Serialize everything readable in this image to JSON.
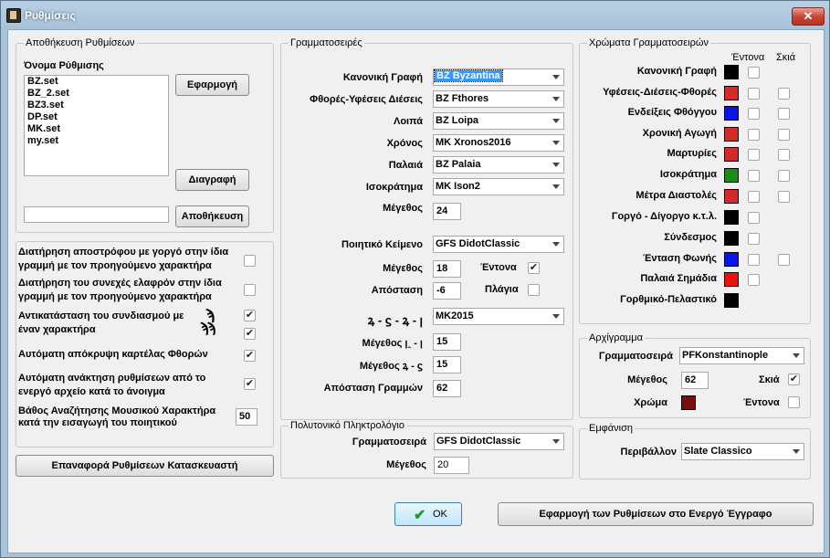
{
  "window": {
    "title": "Ρυθμίσεις",
    "close_glyph": "✕"
  },
  "save_settings": {
    "group_label": "Αποθήκευση Ρυθμίσεων",
    "name_label": "Όνομα Ρύθμισης",
    "items": [
      "BZ.set",
      "BZ_2.set",
      "BZ3.set",
      "DP.set",
      "MK.set",
      "my.set"
    ],
    "apply_button": "Εφαρμογή",
    "delete_button": "Διαγραφή",
    "save_button": "Αποθήκευση",
    "name_value": ""
  },
  "options": {
    "keep_apostrophe": {
      "label": "Διατήρηση αποστρόφου με γοργό στην ίδια γραμμή με τον προηγούμενο χαρακτήρα",
      "checked": false
    },
    "keep_continuous": {
      "label": "Διατήρηση του συνεχές ελαφρόν στην ίδια γραμμή με τον προηγούμενο χαρακτήρα",
      "checked": false
    },
    "replace_combo": {
      "label": "Αντικατάσταση του συνδιασμού με έναν χαρακτήρα",
      "checked_1": true,
      "checked_2": true,
      "glyph_1": "ϡ",
      "glyph_2": "ϡϡ"
    },
    "auto_hide_phthora_tab": {
      "label": "Αυτόματη απόκρυψη καρτέλας Φθορών",
      "checked": true
    },
    "auto_load_settings": {
      "label": "Αυτόματη ανάκτηση ρυθμίσεων από το ενεργό αρχείο κατά το άνοιγμα",
      "checked": true
    },
    "search_depth": {
      "label": "Βάθος Αναζήτησης Μουσικού Χαρακτήρα κατά την εισαγωγή του ποιητικού",
      "value": "50"
    }
  },
  "restore_button": "Επαναφορά Ρυθμίσεων  Κατασκευαστή",
  "fonts": {
    "group_label": "Γραμματοσειρές",
    "rows": [
      {
        "label": "Κανονική Γραφή",
        "value": "BZ Byzantina"
      },
      {
        "label": "Φθορές-Υφέσεις Διέσεις",
        "value": "BZ Fthores"
      },
      {
        "label": "Λοιπά",
        "value": "BZ Loipa"
      },
      {
        "label": "Χρόνος",
        "value": "MK Xronos2016"
      },
      {
        "label": "Παλαιά",
        "value": "BZ Palaia"
      },
      {
        "label": "Ισοκράτημα",
        "value": "MK Ison2"
      }
    ],
    "size_label": "Μέγεθος",
    "size_value": "24",
    "poetic_label": "Ποιητικό Κείμενο",
    "poetic_value": "GFS DidotClassic",
    "poetic_size_label": "Μέγεθος",
    "poetic_size_value": "18",
    "bold_label": "Έντονα",
    "bold_checked": true,
    "distance_label": "Απόσταση",
    "distance_value": "-6",
    "italic_label": "Πλάγια",
    "italic_checked": false,
    "martyria_label": "ꝝ - ϛ - ꝝ - ꞁ",
    "martyria_value": "MK2015",
    "size_a_label": "Μέγεθος  ꞁꞈ - ꞁ",
    "size_a_value": "15",
    "size_b_label": "Μέγεθος  ꝝ - ϛ",
    "size_b_value": "15",
    "line_distance_label": "Απόσταση Γραμμών",
    "line_distance_value": "62"
  },
  "polytonic": {
    "group_label": "Πολυτονικό Πληκτρολόγιο",
    "font_label": "Γραμματοσειρά",
    "font_value": "GFS DidotClassic",
    "size_label": "Μέγεθος",
    "size_value": "20"
  },
  "font_colors": {
    "group_label": "Χρώματα Γραμματοσειρών",
    "bold_header": "Έντονα",
    "shadow_header": "Σκιά",
    "rows": [
      {
        "label": "Κανονική Γραφή",
        "color": "#000000",
        "bold": false,
        "shadow": null
      },
      {
        "label": "Υφέσεις-Διέσεις-Φθορές",
        "color": "#d42a2a",
        "bold": false,
        "shadow": false
      },
      {
        "label": "Ενδείξεις Φθόγγου",
        "color": "#0a14e6",
        "bold": false,
        "shadow": false
      },
      {
        "label": "Χρονική Αγωγή",
        "color": "#d42a2a",
        "bold": false,
        "shadow": false
      },
      {
        "label": "Μαρτυρίες",
        "color": "#d42a2a",
        "bold": false,
        "shadow": false
      },
      {
        "label": "Ισοκράτημα",
        "color": "#1a8a1a",
        "bold": false,
        "shadow": false
      },
      {
        "label": "Μέτρα Διαστολές",
        "color": "#d42a2a",
        "bold": false,
        "shadow": false
      },
      {
        "label": "Γοργό - Δίγοργο κ.τ.λ.",
        "color": "#000000",
        "bold": false,
        "shadow": null
      },
      {
        "label": "Σύνδεσμος",
        "color": "#000000",
        "bold": false,
        "shadow": null
      },
      {
        "label": "Ένταση Φωνής",
        "color": "#0a14e6",
        "bold": false,
        "shadow": false
      },
      {
        "label": "Παλαιά Σημάδια",
        "color": "#ee1010",
        "bold": false,
        "shadow": null
      },
      {
        "label": "Γορθμικό-Πελαστικό",
        "color": "#000000",
        "bold": null,
        "shadow": null
      }
    ]
  },
  "initial": {
    "group_label": "Αρχίγραμμα",
    "font_label": "Γραμματοσειρά",
    "font_value": "PFKonstantinople",
    "size_label": "Μέγεθος",
    "size_value": "62",
    "shadow_label": "Σκιά",
    "shadow_checked": true,
    "color_label": "Χρώμα",
    "color": "#7a0c0c",
    "bold_label": "Έντονα",
    "bold_checked": false
  },
  "appearance": {
    "group_label": "Εμφάνιση",
    "env_label": "Περιβάλλον",
    "env_value": "Slate Classico"
  },
  "ok_button": "OK",
  "apply_doc_button": "Εφαρμογή των Ρυθμίσεων στο Ενεργό  Έγγραφο"
}
